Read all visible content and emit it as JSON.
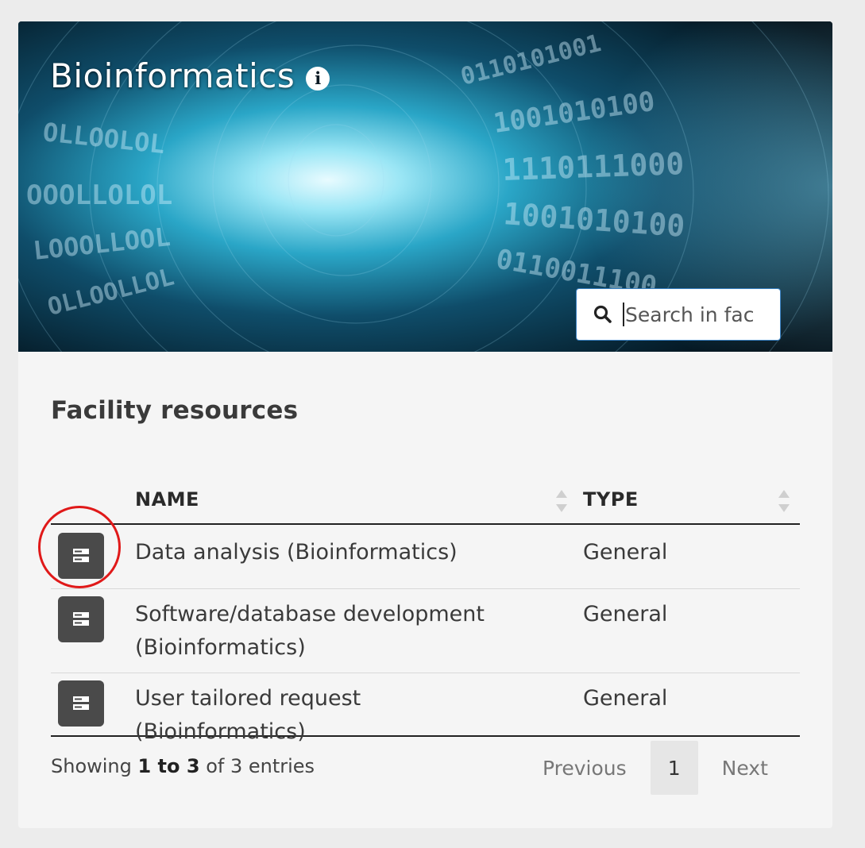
{
  "banner": {
    "title": "Bioinformatics",
    "info_icon": "info-icon",
    "search": {
      "placeholder": "Search in fac",
      "icon": "search-icon"
    }
  },
  "section": {
    "title": "Facility resources"
  },
  "table": {
    "columns": [
      {
        "label": "NAME",
        "sort_icon": "sort-icon"
      },
      {
        "label": "TYPE",
        "sort_icon": "sort-icon"
      }
    ],
    "rows": [
      {
        "icon": "server-icon",
        "name": "Data analysis (Bioinformatics)",
        "type": "General"
      },
      {
        "icon": "server-icon",
        "name": "Software/database development (Bioinformatics)",
        "type": "General"
      },
      {
        "icon": "server-icon",
        "name": "User tailored request (Bioinformatics)",
        "type": "General"
      }
    ]
  },
  "footer": {
    "showing_prefix": "Showing ",
    "range": "1 to 3",
    "showing_suffix": " of 3 entries",
    "pagination": {
      "previous": "Previous",
      "current_page": "1",
      "next": "Next"
    }
  },
  "colors": {
    "page_bg": "#ececec",
    "card_bg": "#f5f5f5",
    "icon_button_bg": "#4a4a4a",
    "highlight": "#e01919",
    "search_border": "#3b82c4"
  }
}
